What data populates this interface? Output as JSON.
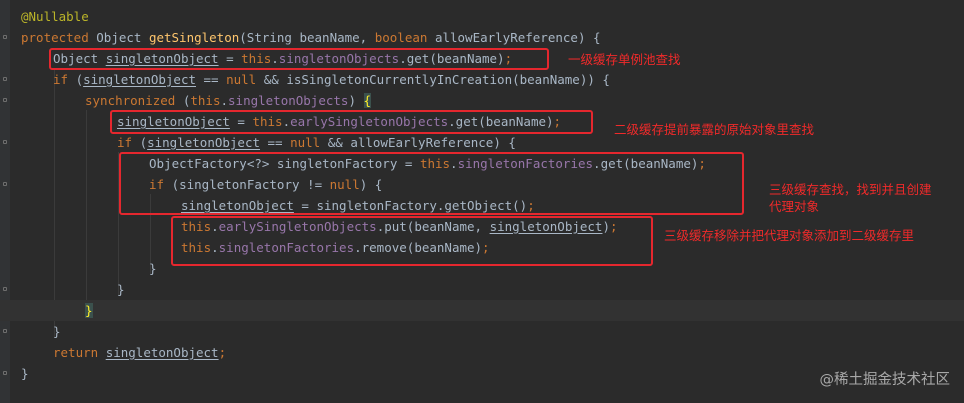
{
  "editor": {
    "lines": [
      {
        "indent": 0,
        "current": false,
        "tokens": [
          {
            "t": "@Nullable",
            "c": "ann"
          }
        ]
      },
      {
        "indent": 0,
        "current": false,
        "tokens": [
          {
            "t": "protected ",
            "c": "kw"
          },
          {
            "t": "Object ",
            "c": "pl"
          },
          {
            "t": "getSingleton",
            "c": "fn"
          },
          {
            "t": "(String beanName, ",
            "c": "pl"
          },
          {
            "t": "boolean ",
            "c": "kw"
          },
          {
            "t": "allowEarlyReference) {",
            "c": "pl"
          }
        ]
      },
      {
        "indent": 1,
        "current": false,
        "tokens": [
          {
            "t": "Object ",
            "c": "pl"
          },
          {
            "t": "singletonObject",
            "c": "pl u"
          },
          {
            "t": " = ",
            "c": "pl"
          },
          {
            "t": "this",
            "c": "kw"
          },
          {
            "t": ".",
            "c": "pl"
          },
          {
            "t": "singletonObjects",
            "c": "fld"
          },
          {
            "t": ".get(beanName)",
            "c": "pl"
          },
          {
            "t": ";",
            "c": "kw"
          }
        ]
      },
      {
        "indent": 1,
        "current": false,
        "tokens": [
          {
            "t": "if ",
            "c": "kw"
          },
          {
            "t": "(",
            "c": "pl"
          },
          {
            "t": "singletonObject",
            "c": "pl u"
          },
          {
            "t": " == ",
            "c": "pl"
          },
          {
            "t": "null ",
            "c": "kw"
          },
          {
            "t": "&& isSingletonCurrentlyInCreation(beanName)) {",
            "c": "pl"
          }
        ]
      },
      {
        "indent": 2,
        "current": false,
        "tokens": [
          {
            "t": "synchronized ",
            "c": "kw"
          },
          {
            "t": "(",
            "c": "pl"
          },
          {
            "t": "this",
            "c": "kw"
          },
          {
            "t": ".",
            "c": "pl"
          },
          {
            "t": "singletonObjects",
            "c": "fld"
          },
          {
            "t": ") ",
            "c": "pl"
          },
          {
            "t": "{",
            "c": "brace-hl"
          }
        ]
      },
      {
        "indent": 3,
        "current": false,
        "tokens": [
          {
            "t": "singletonObject",
            "c": "pl u"
          },
          {
            "t": " = ",
            "c": "pl"
          },
          {
            "t": "this",
            "c": "kw"
          },
          {
            "t": ".",
            "c": "pl"
          },
          {
            "t": "earlySingletonObjects",
            "c": "fld"
          },
          {
            "t": ".get(beanName)",
            "c": "pl"
          },
          {
            "t": ";",
            "c": "kw"
          }
        ]
      },
      {
        "indent": 3,
        "current": false,
        "tokens": [
          {
            "t": "if ",
            "c": "kw"
          },
          {
            "t": "(",
            "c": "pl"
          },
          {
            "t": "singletonObject",
            "c": "pl u"
          },
          {
            "t": " == ",
            "c": "pl"
          },
          {
            "t": "null ",
            "c": "kw"
          },
          {
            "t": "&& allowEarlyReference) {",
            "c": "pl"
          }
        ]
      },
      {
        "indent": 4,
        "current": false,
        "tokens": [
          {
            "t": "ObjectFactory<?> singletonFactory = ",
            "c": "pl"
          },
          {
            "t": "this",
            "c": "kw"
          },
          {
            "t": ".",
            "c": "pl"
          },
          {
            "t": "singletonFactories",
            "c": "fld"
          },
          {
            "t": ".get(beanName)",
            "c": "pl"
          },
          {
            "t": ";",
            "c": "kw"
          }
        ]
      },
      {
        "indent": 4,
        "current": false,
        "tokens": [
          {
            "t": "if ",
            "c": "kw"
          },
          {
            "t": "(singletonFactory != ",
            "c": "pl"
          },
          {
            "t": "null",
            "c": "kw"
          },
          {
            "t": ") {",
            "c": "pl"
          }
        ]
      },
      {
        "indent": 5,
        "current": false,
        "tokens": [
          {
            "t": "singletonObject",
            "c": "pl u"
          },
          {
            "t": " = singletonFactory.getObject()",
            "c": "pl"
          },
          {
            "t": ";",
            "c": "kw"
          }
        ]
      },
      {
        "indent": 5,
        "current": false,
        "tokens": [
          {
            "t": "this",
            "c": "kw"
          },
          {
            "t": ".",
            "c": "pl"
          },
          {
            "t": "earlySingletonObjects",
            "c": "fld"
          },
          {
            "t": ".put(beanName, ",
            "c": "pl"
          },
          {
            "t": "singletonObject",
            "c": "pl u"
          },
          {
            "t": ")",
            "c": "pl"
          },
          {
            "t": ";",
            "c": "kw"
          }
        ]
      },
      {
        "indent": 5,
        "current": false,
        "tokens": [
          {
            "t": "this",
            "c": "kw"
          },
          {
            "t": ".",
            "c": "pl"
          },
          {
            "t": "singletonFactories",
            "c": "fld"
          },
          {
            "t": ".remove(beanName)",
            "c": "pl"
          },
          {
            "t": ";",
            "c": "kw"
          }
        ]
      },
      {
        "indent": 4,
        "current": false,
        "tokens": [
          {
            "t": "}",
            "c": "pl"
          }
        ]
      },
      {
        "indent": 3,
        "current": false,
        "tokens": [
          {
            "t": "}",
            "c": "pl"
          }
        ]
      },
      {
        "indent": 2,
        "current": true,
        "tokens": [
          {
            "t": "}",
            "c": "brace-hl"
          }
        ]
      },
      {
        "indent": 1,
        "current": false,
        "tokens": [
          {
            "t": "}",
            "c": "pl"
          }
        ]
      },
      {
        "indent": 1,
        "current": false,
        "tokens": [
          {
            "t": "return ",
            "c": "kw"
          },
          {
            "t": "singletonObject",
            "c": "pl u"
          },
          {
            "t": ";",
            "c": "kw"
          }
        ]
      },
      {
        "indent": 0,
        "current": false,
        "tokens": [
          {
            "t": "}",
            "c": "pl"
          }
        ]
      }
    ]
  },
  "annotations": [
    {
      "text": "一级缓存单例池查找"
    },
    {
      "text": "二级缓存提前暴露的原始对象里查找"
    },
    {
      "text": "三级缓存查找，找到并且创建\n代理对象"
    },
    {
      "text": "三级缓存移除并把代理对象添加到二级缓存里"
    }
  ],
  "watermark": "@稀土掘金技术社区",
  "colors": {
    "background": "#2b2b2b",
    "keyword": "#cc7832",
    "method": "#ffc66d",
    "field": "#9876aa",
    "annotation": "#bbb529",
    "plain": "#a9b7c6",
    "highlight_box": "#e5272e"
  }
}
